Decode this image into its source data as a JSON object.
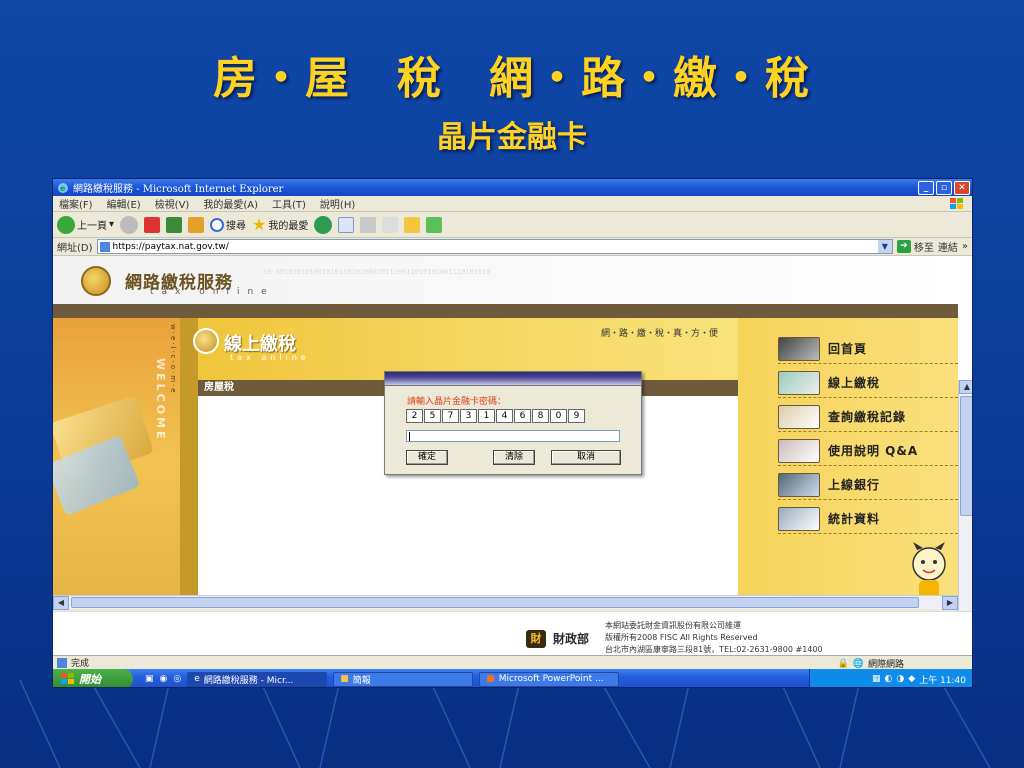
{
  "slide": {
    "title": "房・屋　稅　網・路・繳・稅",
    "subtitle": "晶片金融卡"
  },
  "browser": {
    "window_title": "網路繳稅服務 - Microsoft Internet Explorer",
    "menu": [
      "檔案(F)",
      "編輯(E)",
      "檢視(V)",
      "我的最愛(A)",
      "工具(T)",
      "說明(H)"
    ],
    "toolbar": {
      "back": "上一頁",
      "search": "搜尋",
      "favorites": "我的最愛"
    },
    "address_label": "網址(D)",
    "address_value": "https://paytax.nat.gov.tw/",
    "go_label": "移至",
    "links_label": "連結",
    "status_text": "完成",
    "zone_label": "網際網路"
  },
  "site": {
    "header_title": "網路繳稅服務",
    "header_sub": "tax online",
    "binary": "10·001010101001010110101000101110011010101001110101010",
    "online_title": "線上繳稅",
    "online_sub": "tax online",
    "slogan": "網・路・繳・稅・真・方・便",
    "welcome": "WELCOME",
    "dots": "w·e·l·c·o·m·e",
    "tax_section": "房屋稅",
    "menu": [
      {
        "label": "回首頁"
      },
      {
        "label": "線上繳稅"
      },
      {
        "label": "查詢繳稅記錄"
      },
      {
        "label": "使用說明 Q&A"
      },
      {
        "label": "上線銀行"
      },
      {
        "label": "統計資料"
      }
    ]
  },
  "dialog": {
    "prompt": "請輸入晶片金融卡密碼：",
    "keys": [
      "2",
      "5",
      "7",
      "3",
      "1",
      "4",
      "6",
      "8",
      "0",
      "9"
    ],
    "ok_label": "確定",
    "clear_label": "清除",
    "cancel_label": "取消"
  },
  "footer": {
    "mof_label": "財政部",
    "line1": "本網站委託財金資訊股份有限公司維運",
    "line2": "版權所有2008 FISC All Rights Reserved",
    "line3": "台北市內湖區康寧路三段81號，TEL:02-2631-9800 #1400"
  },
  "taskbar": {
    "start": "開始",
    "task1": "網路繳稅服務 - Micr...",
    "task2": "簡報",
    "task3": "Microsoft PowerPoint ...",
    "clock": "上午 11:40"
  }
}
